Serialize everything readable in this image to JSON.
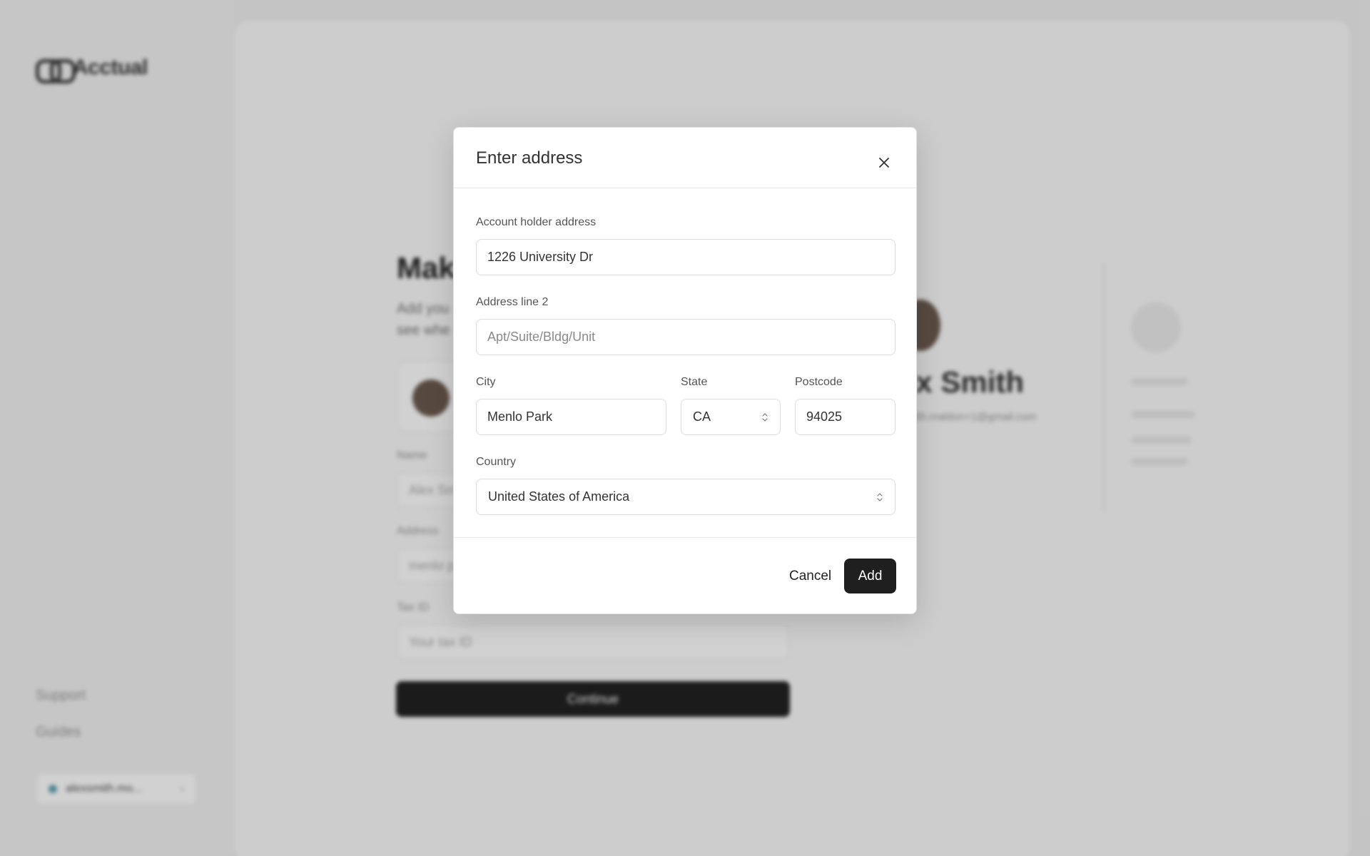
{
  "app": {
    "logo_text": "Acctual"
  },
  "sidebar": {
    "support_label": "Support",
    "guides_label": "Guides",
    "account_label": "alexsmith.mo..."
  },
  "background": {
    "heading": "Mak",
    "subtext_line1": "Add you",
    "subtext_line2": "see whe",
    "name_label": "Name",
    "name_value": "Alex Sm",
    "address_label": "Address",
    "address_value": "menlo p",
    "tax_label": "Tax ID",
    "tax_placeholder": "Your tax ID",
    "continue_label": "Continue",
    "profile_name": "ex Smith",
    "profile_email": "mith.maldon+1@gmail.com"
  },
  "modal": {
    "title": "Enter address",
    "close_icon": "close-icon",
    "address_label": "Account holder address",
    "address_value": "1226 University Dr",
    "address2_label": "Address line 2",
    "address2_placeholder": "Apt/Suite/Bldg/Unit",
    "city_label": "City",
    "city_value": "Menlo Park",
    "state_label": "State",
    "state_value": "CA",
    "postcode_label": "Postcode",
    "postcode_value": "94025",
    "country_label": "Country",
    "country_value": "United States of America",
    "cancel_label": "Cancel",
    "add_label": "Add"
  },
  "colors": {
    "primary_button": "#1f1f1f",
    "overlay": "rgba(0,0,0,0.18)"
  }
}
